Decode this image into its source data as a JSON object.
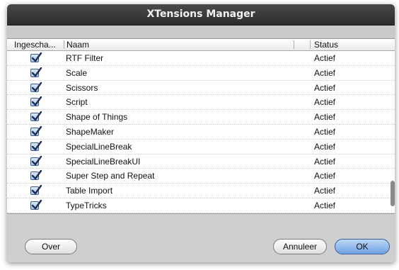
{
  "window": {
    "title": "XTensions Manager"
  },
  "table": {
    "columns": {
      "enabled": "Ingescha...",
      "name": "Naam",
      "status": "Status"
    },
    "rows": [
      {
        "enabled": true,
        "name": "RTF Filter",
        "status": "Actief"
      },
      {
        "enabled": true,
        "name": "Scale",
        "status": "Actief"
      },
      {
        "enabled": true,
        "name": "Scissors",
        "status": "Actief"
      },
      {
        "enabled": true,
        "name": "Script",
        "status": "Actief"
      },
      {
        "enabled": true,
        "name": "Shape of Things",
        "status": "Actief"
      },
      {
        "enabled": true,
        "name": "ShapeMaker",
        "status": "Actief"
      },
      {
        "enabled": true,
        "name": "SpecialLineBreak",
        "status": "Actief"
      },
      {
        "enabled": true,
        "name": "SpecialLineBreakUI",
        "status": "Actief"
      },
      {
        "enabled": true,
        "name": "Super Step and Repeat",
        "status": "Actief"
      },
      {
        "enabled": true,
        "name": "Table Import",
        "status": "Actief"
      },
      {
        "enabled": true,
        "name": "TypeTricks",
        "status": "Actief"
      }
    ]
  },
  "buttons": {
    "about": "Over",
    "cancel": "Annuleer",
    "ok": "OK"
  },
  "icons": {
    "checkbox": "checkbox-checked-icon"
  },
  "colors": {
    "titlebar": "#2c2c2c",
    "default_button": "#6fa2e3",
    "checkbox": "#3c5d8c"
  }
}
